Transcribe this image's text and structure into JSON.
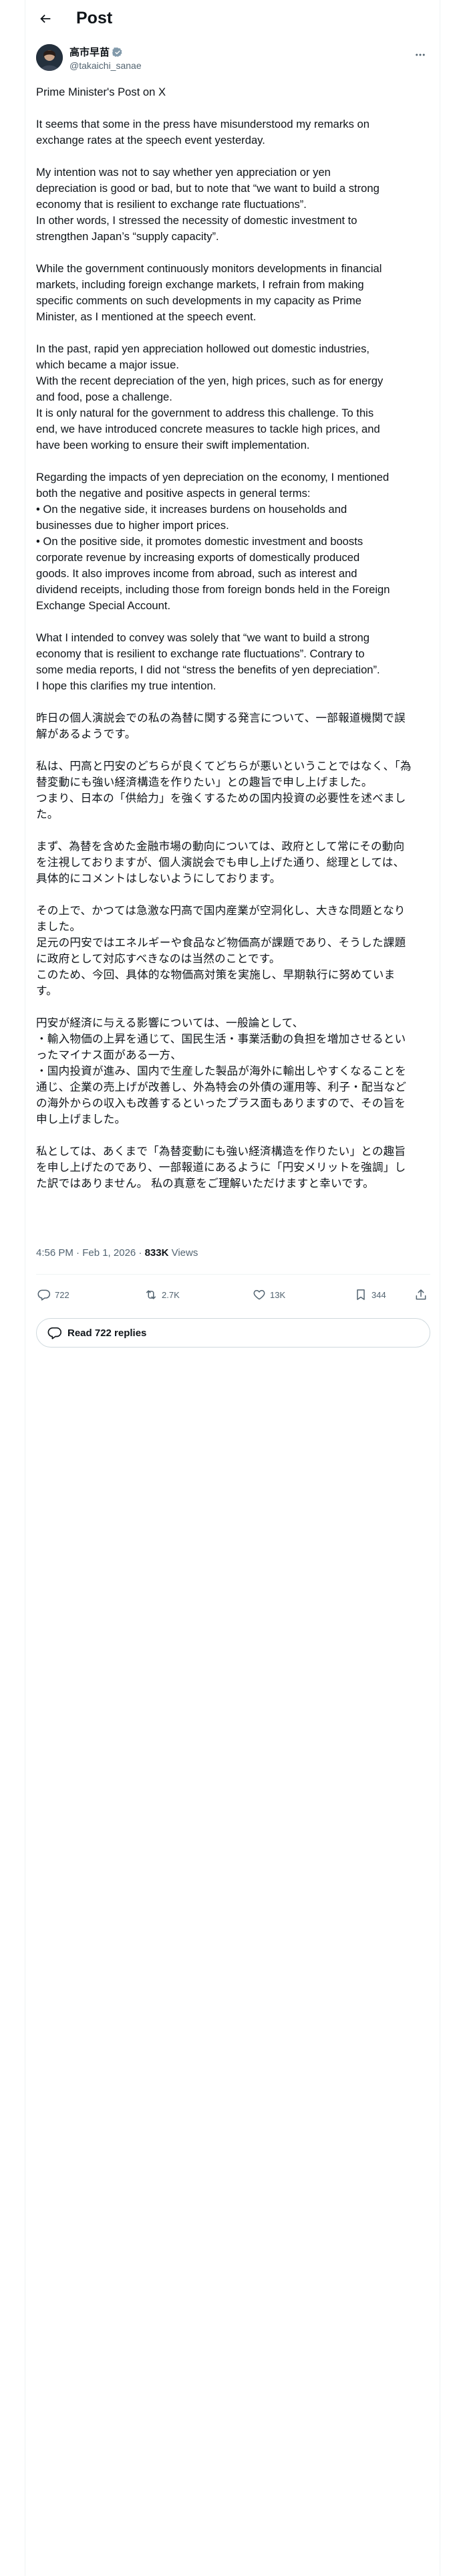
{
  "header": {
    "title": "Post"
  },
  "author": {
    "display_name": "高市早苗",
    "handle": "@takaichi_sanae"
  },
  "post": {
    "lines": [
      "Prime Minister's Post on X",
      "",
      "It seems that some in the press have misunderstood my remarks on",
      "exchange rates at the speech event yesterday.",
      "",
      "My intention was not to say whether yen appreciation or yen",
      "depreciation is good or bad, but to note that “we want to build a strong",
      "economy that is resilient to exchange rate fluctuations”.",
      "In other words, I stressed the necessity of domestic investment to",
      "strengthen Japan’s “supply capacity”.",
      "",
      "While the government continuously monitors developments in financial",
      "markets, including foreign exchange markets, I refrain from making",
      "specific comments on such developments in my capacity as Prime",
      "Minister, as I mentioned at the speech event.",
      "",
      "In the past, rapid yen appreciation hollowed out domestic industries,",
      "which became a major issue.",
      "With the recent depreciation of the yen, high prices, such as for energy",
      "and food, pose a challenge.",
      "It is only natural for the government to address this challenge. To this",
      "end, we have introduced concrete measures to tackle high prices, and",
      "have been working to ensure their swift implementation.",
      "",
      "Regarding the impacts of yen depreciation on the economy, I mentioned",
      "both the negative and positive aspects in general terms:",
      "• On the negative side, it increases burdens on households and",
      "businesses due to higher import prices.",
      "• On the positive side, it promotes domestic investment and boosts",
      "corporate revenue by increasing exports of domestically produced",
      "goods. It also improves income from abroad, such as interest and",
      "dividend receipts, including those from foreign bonds held in the Foreign",
      "Exchange Special Account.",
      "",
      "What I intended to convey was solely that “we want to build a strong",
      "economy that is resilient to exchange rate fluctuations”. Contrary to",
      "some media reports, I did not “stress the benefits of yen depreciation”.",
      "I hope this clarifies my true intention.",
      "",
      "昨日の個人演説会での私の為替に関する発言について、一部報道機関で誤",
      "解があるようです。",
      "",
      "私は、円高と円安のどちらが良くてどちらが悪いということではなく、「為",
      "替変動にも強い経済構造を作りたい」との趣旨で申し上げました。",
      "つまり、日本の「供給力」を強くするための国内投資の必要性を述べまし",
      "た。",
      "",
      "まず、為替を含めた金融市場の動向については、政府として常にその動向",
      "を注視しておりますが、個人演説会でも申し上げた通り、総理としては、",
      "具体的にコメントはしないようにしております。",
      "",
      "その上で、かつては急激な円高で国内産業が空洞化し、大きな問題となり",
      "ました。",
      "足元の円安ではエネルギーや食品など物価高が課題であり、そうした課題",
      "に政府として対応すべきなのは当然のことです。",
      "このため、今回、具体的な物価高対策を実施し、早期執行に努めていま",
      "す。",
      "",
      "円安が経済に与える影響については、一般論として、",
      "・輸入物価の上昇を通じて、国民生活・事業活動の負担を増加させるとい",
      "ったマイナス面がある一方、",
      "・国内投資が進み、国内で生産した製品が海外に輸出しやすくなることを",
      "通じ、企業の売上げが改善し、外為特会の外債の運用等、利子・配当など",
      "の海外からの収入も改善するといったプラス面もありますので、その旨を",
      "申し上げました。",
      "",
      "私としては、あくまで「為替変動にも強い経済構造を作りたい」との趣旨",
      "を申し上げたのであり、一部報道にあるように「円安メリットを強調」し",
      "た訳ではありません。 私の真意をご理解いただけますと幸いです。"
    ],
    "timestamp": "4:56 PM · Feb 1, 2026 · ",
    "views_count": "833K",
    "views_label": " Views"
  },
  "actions": {
    "replies": "722",
    "reposts": "2.7K",
    "likes": "13K",
    "bookmarks": "344"
  },
  "read_replies_label": "Read 722 replies",
  "colors": {
    "verified": "#829aab",
    "text": "#0f1419",
    "secondary": "#536471",
    "border": "#eff3f4"
  }
}
